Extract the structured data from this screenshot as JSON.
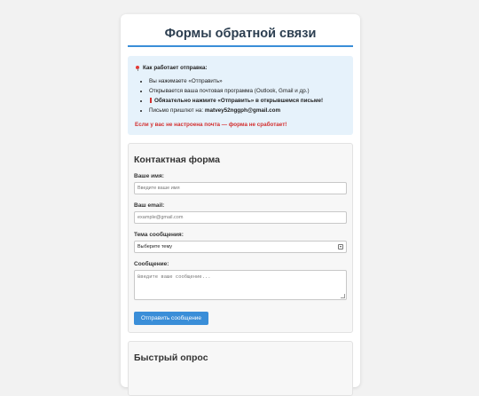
{
  "page": {
    "title": "Формы обратной связи"
  },
  "info": {
    "heading": "Как работает отправка:",
    "items": [
      "Вы нажимаете «Отправить»",
      "Открывается ваша почтовая программа (Outlook, Gmail и др.)",
      "Обязательно нажмите «Отправить» в открывшемся письме!",
      "Письмо пришлют на:"
    ],
    "email": "matvey52nggph@gmail.com",
    "warning": "Если у вас не настроена почта — форма не сработает!"
  },
  "contact_form": {
    "title": "Контактная форма",
    "name_label": "Ваше имя:",
    "name_placeholder": "Введите ваше имя",
    "email_label": "Ваш email:",
    "email_placeholder": "example@gmail.com",
    "topic_label": "Тема сообщения:",
    "topic_selected": "Выберите тему",
    "message_label": "Сообщение:",
    "message_placeholder": "Введите ваше сообщение...",
    "submit_label": "Отправить сообщение"
  },
  "survey": {
    "title": "Быстрый опрос"
  },
  "colors": {
    "accent": "#3a8ed8",
    "warning": "#d32f2f",
    "info_bg": "#e6f2fb"
  }
}
